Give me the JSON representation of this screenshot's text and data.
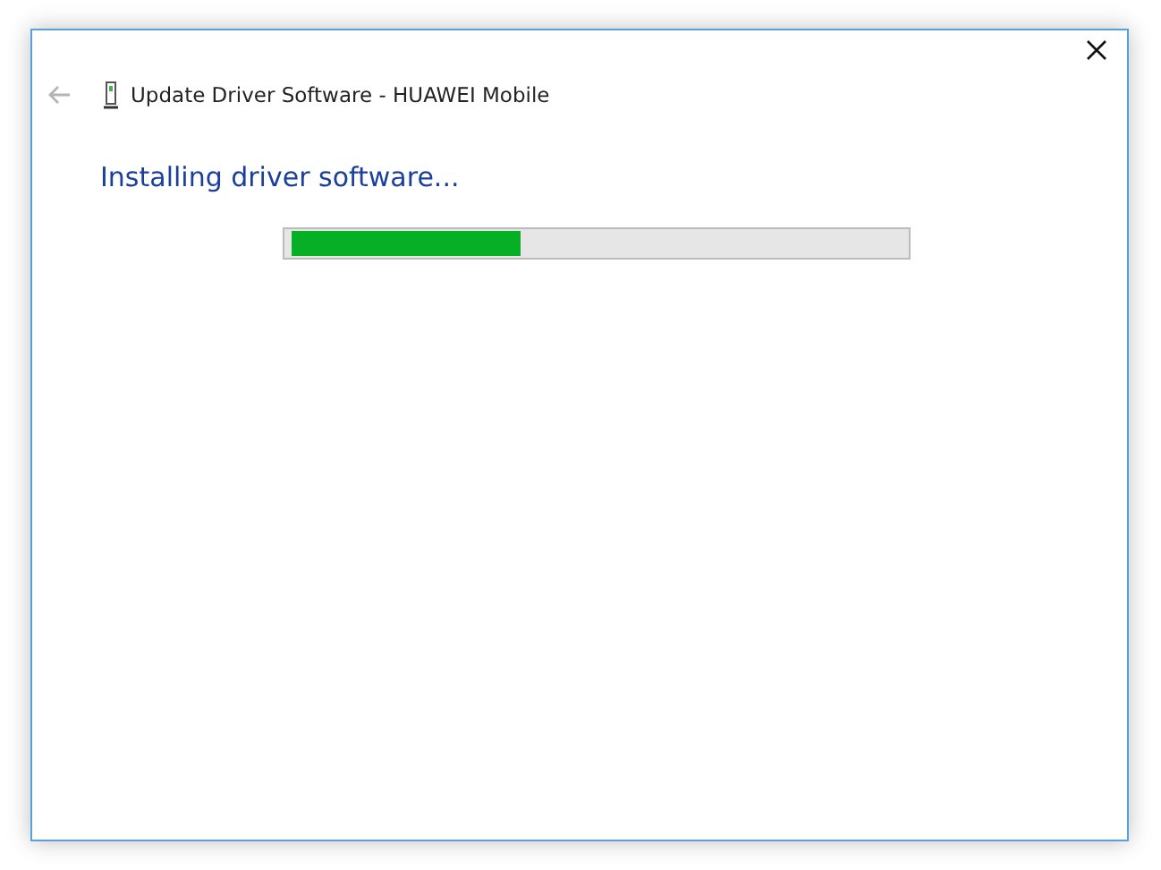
{
  "window": {
    "title": "Update Driver Software - HUAWEI Mobile"
  },
  "heading": "Installing driver software...",
  "progress": {
    "level": 0.37
  }
}
